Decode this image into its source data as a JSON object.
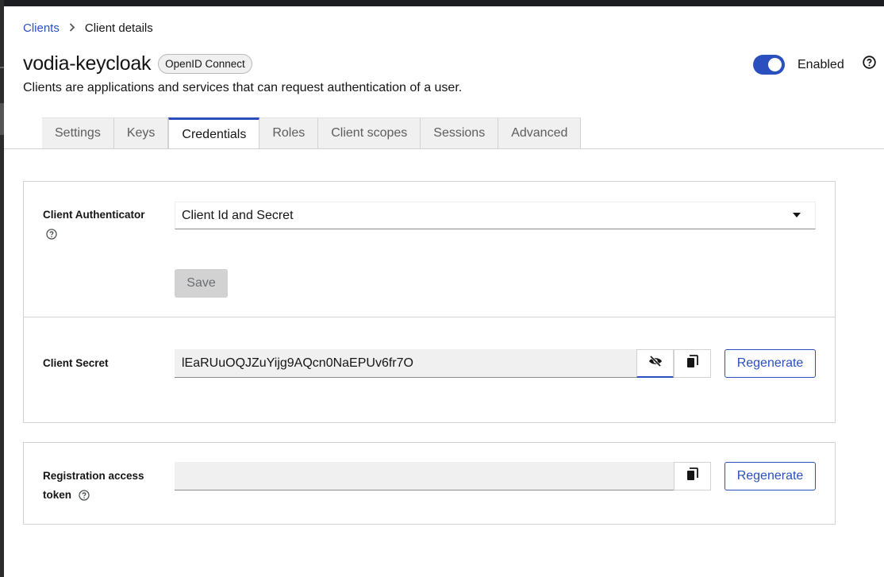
{
  "breadcrumb": {
    "parent": "Clients",
    "current": "Client details"
  },
  "header": {
    "title": "vodia-keycloak",
    "protocol_badge": "OpenID Connect",
    "description": "Clients are applications and services that can request authentication of a user.",
    "enabled_label": "Enabled",
    "enabled": true
  },
  "tabs": [
    {
      "label": "Settings"
    },
    {
      "label": "Keys"
    },
    {
      "label": "Credentials",
      "active": true
    },
    {
      "label": "Roles"
    },
    {
      "label": "Client scopes"
    },
    {
      "label": "Sessions"
    },
    {
      "label": "Advanced"
    }
  ],
  "credentials": {
    "authenticator_label": "Client Authenticator",
    "authenticator_value": "Client Id and Secret",
    "save_label": "Save",
    "secret_label": "Client Secret",
    "secret_value": "lEaRUuOQJZuYijg9AQcn0NaEPUv6fr7O",
    "regenerate_label": "Regenerate",
    "token_label_line1": "Registration access",
    "token_label_line2": "token",
    "token_value": "",
    "token_regenerate_label": "Regenerate"
  },
  "colors": {
    "accent": "#2b4fbf",
    "disabled_button": "#d2d2d2",
    "input_bg": "#f0f0f0"
  },
  "icons": [
    "chevron-right-icon",
    "help-icon",
    "caret-down-icon",
    "eye-slash-icon",
    "copy-icon"
  ]
}
